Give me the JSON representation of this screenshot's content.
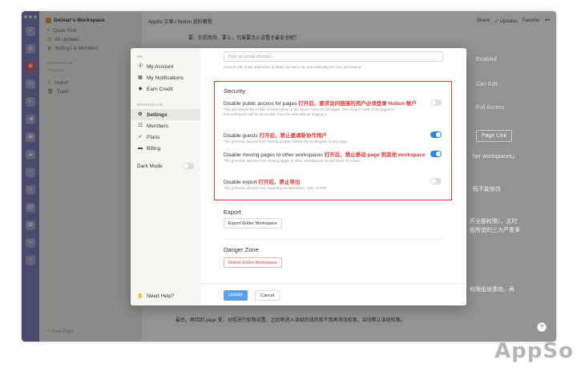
{
  "workspace_name": "Delmar's Workspace",
  "sidebar": {
    "items": [
      "Quick Find",
      "All Updates",
      "Settings & Members"
    ],
    "section_workspace": "WORKSPACE",
    "section_private": "PRIVATE",
    "extra": [
      "Import",
      "Trash"
    ],
    "new_page": "New Page"
  },
  "topbar": {
    "breadcrumb": "AppSo 文章 / Notion 进阶教程",
    "share": "Share",
    "updates": "Updates",
    "favorite": "Favorite"
  },
  "background_text": {
    "line_top": "要、包括危险、要么，究竟要怎么设置才最安全呢？",
    "enabled": "Enabled",
    "can_edit": "Can Edit",
    "full_access": "Full Access",
    "page_link": "Page Link",
    "other_ws": "her workspaces」",
    "cannot_modify": "既不能修改",
    "right1": "开全部权限），这时",
    "right2": "面所说的三大严重事",
    "right3": "权限组境重始。再",
    "bottom": "最后，再回到 page 里，对前进行权限设置，之后新进入该组的成员就不用再添加权限，自动默认该组权限。"
  },
  "modal": {
    "side_header_me": "ME",
    "me_items": [
      "My Account",
      "My Notifications",
      "Earn Credit"
    ],
    "side_header_ws": "WORKSPACE",
    "ws_items": [
      "Settings",
      "Members",
      "Plans",
      "Billing"
    ],
    "dark_mode": "Dark Mode",
    "need_help": "Need Help?",
    "email_placeholder": "Type an email domain...",
    "email_note": "Anyone with email addresses at these domains can automatically join your workspace.",
    "security_title": "Security",
    "options": [
      {
        "label": "Disable public access for pages",
        "note_cn": "打开后，要求访问链接的用户必须登录 Notion 账户",
        "desc": "This will disable the Public Access option in the Share menu for all pages. This means none of the pages in this workspace will be accessible from the web without logging in.",
        "on": false
      },
      {
        "label": "Disable guests",
        "note_cn": "打开后，禁止邀请新协作用户",
        "desc": "This prevents anyone from inviting people outside the workspace to any page.",
        "on": true
      },
      {
        "label": "Disable moving pages to other workspaces",
        "note_cn": "打开后，禁止移动 page 到其他 workspace",
        "desc": "This prevents anyone from moving pages to other workspaces via the Move To action.",
        "on": true
      },
      {
        "label": "Disable export",
        "note_cn": "打开后，禁止导出",
        "desc": "This prevents anyone from exporting as Markdown, CSV, or PDF.",
        "on": false
      }
    ],
    "export_title": "Export",
    "export_button": "Export Entire Workspace",
    "danger_title": "Danger Zone",
    "delete_button": "Delete Entire Workspace",
    "update_button": "Update",
    "cancel_button": "Cancel"
  },
  "watermark": "AppSo",
  "colors": {
    "accent": "#2e84e0",
    "danger": "#e03a3a",
    "dock": "#7a77b8"
  }
}
